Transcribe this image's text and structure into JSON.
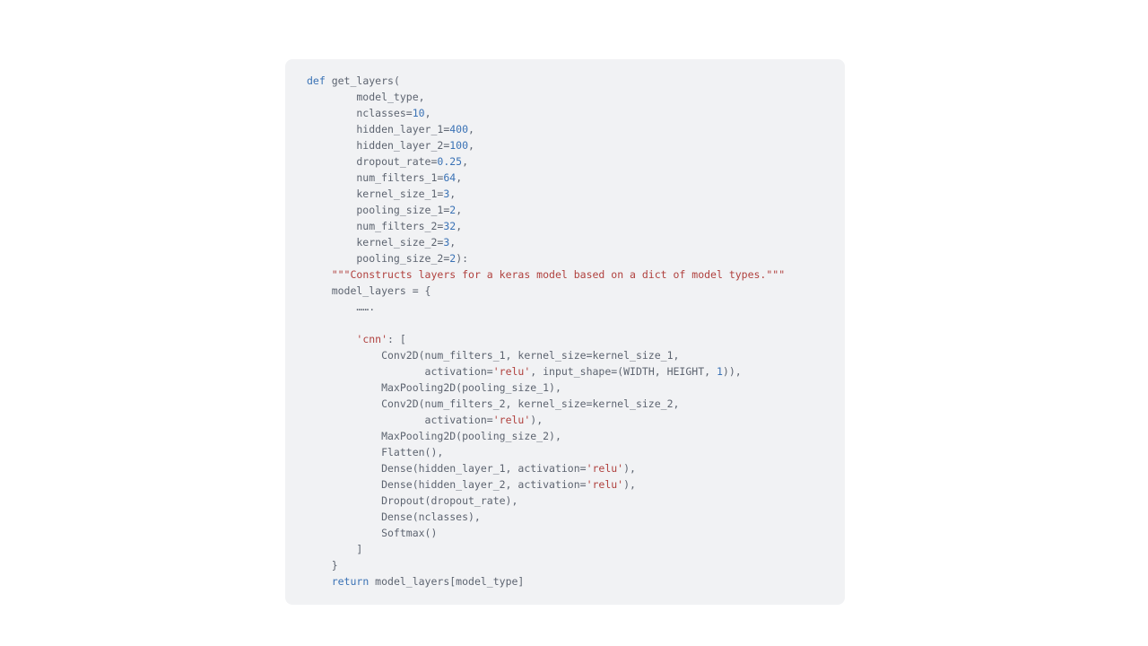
{
  "code": {
    "tokens": [
      {
        "cls": "kw",
        "t": "def"
      },
      {
        "t": " get_layers(\n"
      },
      {
        "t": "        model_type,\n"
      },
      {
        "t": "        nclasses="
      },
      {
        "cls": "num",
        "t": "10"
      },
      {
        "t": ",\n"
      },
      {
        "t": "        hidden_layer_1="
      },
      {
        "cls": "num",
        "t": "400"
      },
      {
        "t": ",\n"
      },
      {
        "t": "        hidden_layer_2="
      },
      {
        "cls": "num",
        "t": "100"
      },
      {
        "t": ",\n"
      },
      {
        "t": "        dropout_rate="
      },
      {
        "cls": "num",
        "t": "0.25"
      },
      {
        "t": ",\n"
      },
      {
        "t": "        num_filters_1="
      },
      {
        "cls": "num",
        "t": "64"
      },
      {
        "t": ",\n"
      },
      {
        "t": "        kernel_size_1="
      },
      {
        "cls": "num",
        "t": "3"
      },
      {
        "t": ",\n"
      },
      {
        "t": "        pooling_size_1="
      },
      {
        "cls": "num",
        "t": "2"
      },
      {
        "t": ",\n"
      },
      {
        "t": "        num_filters_2="
      },
      {
        "cls": "num",
        "t": "32"
      },
      {
        "t": ",\n"
      },
      {
        "t": "        kernel_size_2="
      },
      {
        "cls": "num",
        "t": "3"
      },
      {
        "t": ",\n"
      },
      {
        "t": "        pooling_size_2="
      },
      {
        "cls": "num",
        "t": "2"
      },
      {
        "t": "):\n"
      },
      {
        "t": "    "
      },
      {
        "cls": "str",
        "t": "\"\"\"Constructs layers for a keras model based on a dict of model types.\"\"\""
      },
      {
        "t": "\n"
      },
      {
        "t": "    model_layers = {\n"
      },
      {
        "t": "        …….\n"
      },
      {
        "t": "\n"
      },
      {
        "t": "        "
      },
      {
        "cls": "str",
        "t": "'cnn'"
      },
      {
        "t": ": [\n"
      },
      {
        "t": "            Conv2D(num_filters_1, kernel_size=kernel_size_1,\n"
      },
      {
        "t": "                   activation="
      },
      {
        "cls": "str",
        "t": "'relu'"
      },
      {
        "t": ", input_shape=(WIDTH, HEIGHT, "
      },
      {
        "cls": "num",
        "t": "1"
      },
      {
        "t": ")),\n"
      },
      {
        "t": "            MaxPooling2D(pooling_size_1),\n"
      },
      {
        "t": "            Conv2D(num_filters_2, kernel_size=kernel_size_2,\n"
      },
      {
        "t": "                   activation="
      },
      {
        "cls": "str",
        "t": "'relu'"
      },
      {
        "t": "),\n"
      },
      {
        "t": "            MaxPooling2D(pooling_size_2),\n"
      },
      {
        "t": "            Flatten(),\n"
      },
      {
        "t": "            Dense(hidden_layer_1, activation="
      },
      {
        "cls": "str",
        "t": "'relu'"
      },
      {
        "t": "),\n"
      },
      {
        "t": "            Dense(hidden_layer_2, activation="
      },
      {
        "cls": "str",
        "t": "'relu'"
      },
      {
        "t": "),\n"
      },
      {
        "t": "            Dropout(dropout_rate),\n"
      },
      {
        "t": "            Dense(nclasses),\n"
      },
      {
        "t": "            Softmax()\n"
      },
      {
        "t": "        ]\n"
      },
      {
        "t": "    }\n"
      },
      {
        "t": "    "
      },
      {
        "cls": "kw",
        "t": "return"
      },
      {
        "t": " model_layers[model_type]"
      }
    ]
  }
}
